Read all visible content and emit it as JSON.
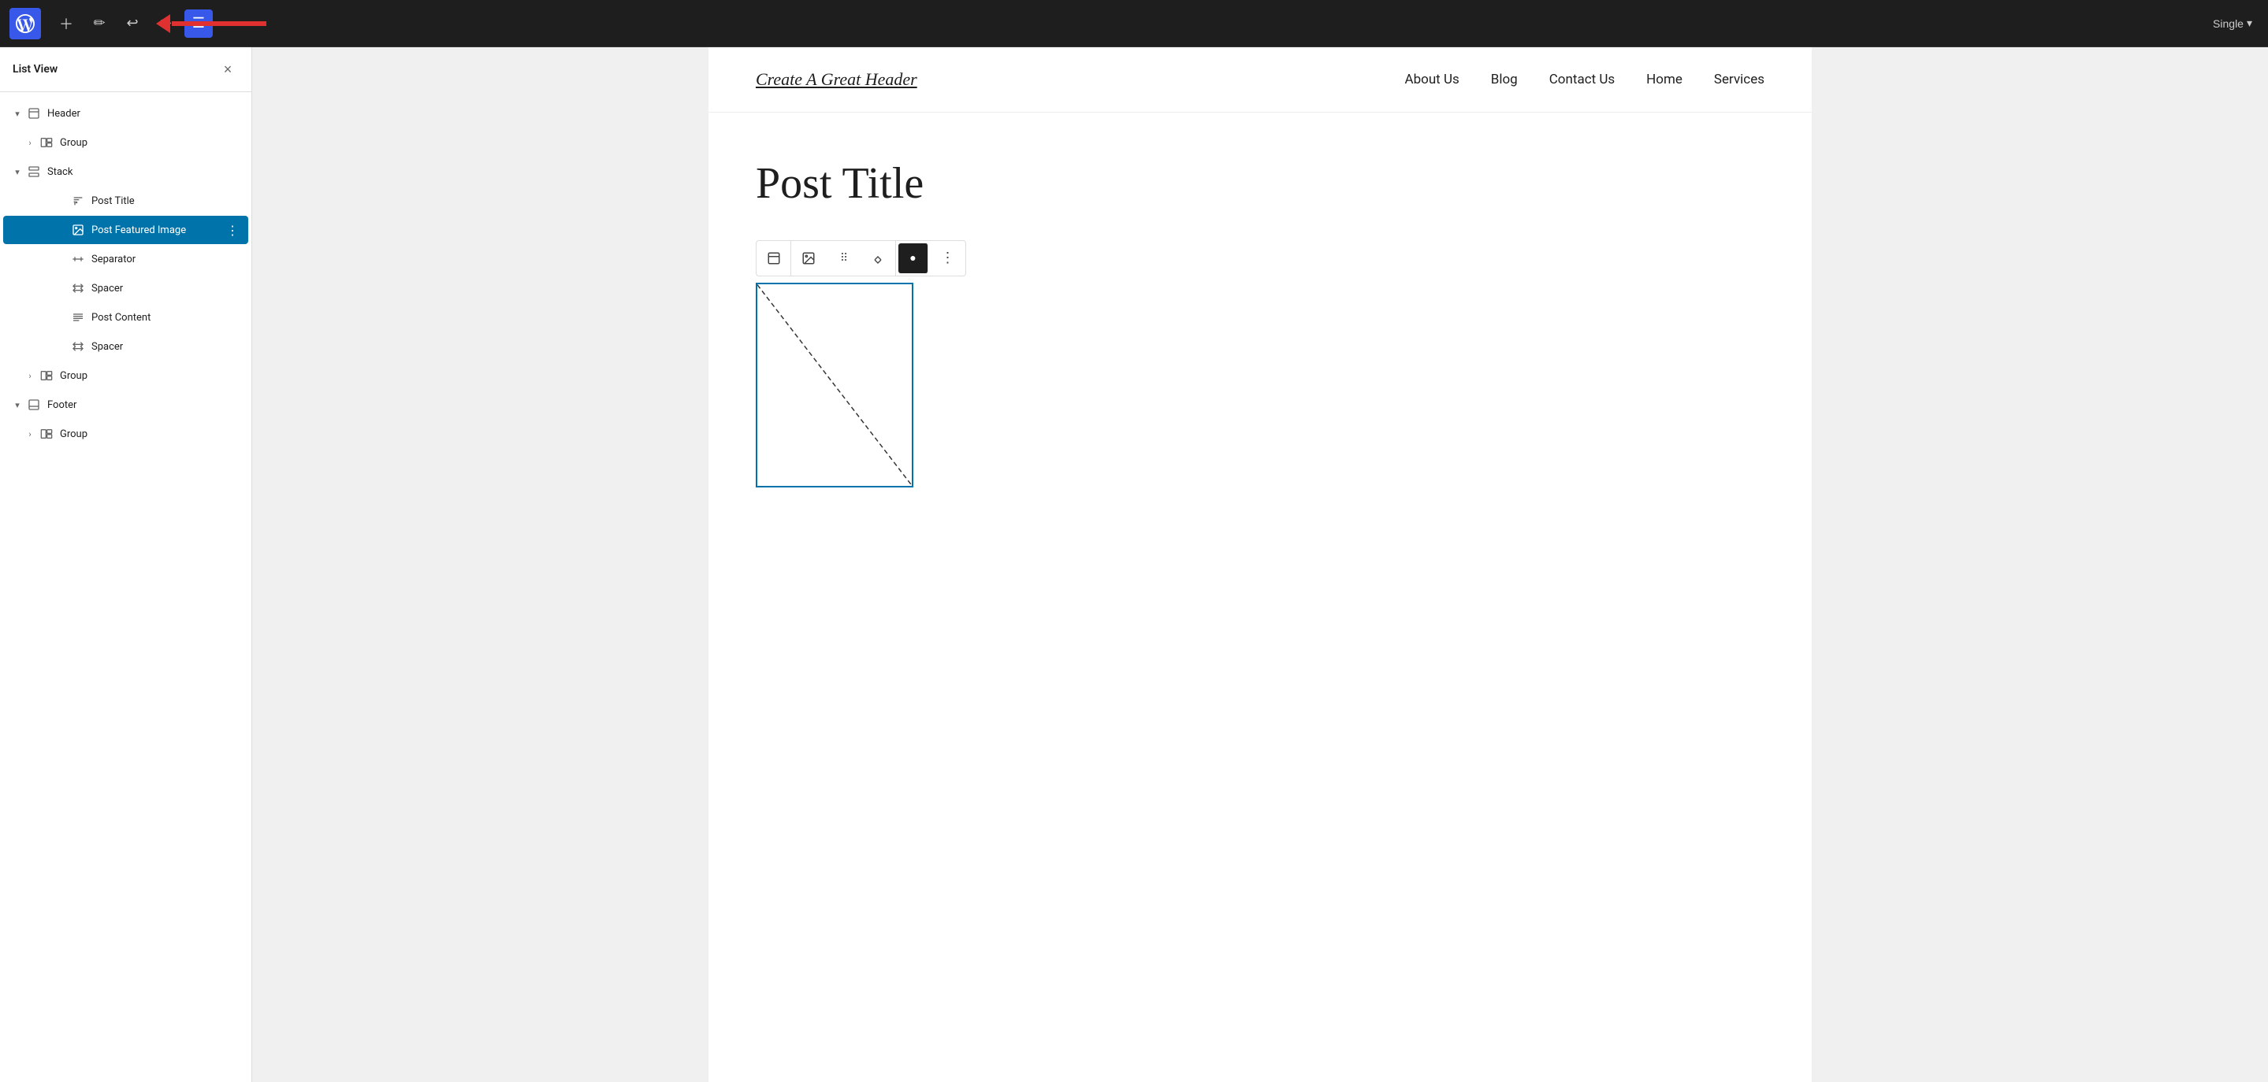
{
  "toolbar": {
    "list_view_label": "≡",
    "pencil_icon": "✏",
    "undo_icon": "↩",
    "redo_icon": "↪",
    "single_label": "Single",
    "dropdown_arrow": "▾"
  },
  "sidebar": {
    "title": "List View",
    "close_icon": "×",
    "items": [
      {
        "id": "header",
        "label": "Header",
        "indent": 0,
        "icon": "template",
        "chevron": "▾",
        "expanded": true
      },
      {
        "id": "group1",
        "label": "Group",
        "indent": 1,
        "icon": "group",
        "chevron": "›",
        "expanded": false
      },
      {
        "id": "stack",
        "label": "Stack",
        "indent": 0,
        "icon": "stack",
        "chevron": "▾",
        "expanded": true
      },
      {
        "id": "post-title",
        "label": "Post Title",
        "indent": 2,
        "icon": "title",
        "chevron": "",
        "expanded": false
      },
      {
        "id": "post-featured-image",
        "label": "Post Featured Image",
        "indent": 2,
        "icon": "image",
        "chevron": "",
        "expanded": false,
        "selected": true
      },
      {
        "id": "separator",
        "label": "Separator",
        "indent": 2,
        "icon": "separator",
        "chevron": "",
        "expanded": false
      },
      {
        "id": "spacer1",
        "label": "Spacer",
        "indent": 2,
        "icon": "spacer",
        "chevron": "",
        "expanded": false
      },
      {
        "id": "post-content",
        "label": "Post Content",
        "indent": 2,
        "icon": "content",
        "chevron": "",
        "expanded": false
      },
      {
        "id": "spacer2",
        "label": "Spacer",
        "indent": 2,
        "icon": "spacer",
        "chevron": "",
        "expanded": false
      },
      {
        "id": "group2",
        "label": "Group",
        "indent": 1,
        "icon": "group",
        "chevron": "›",
        "expanded": false
      },
      {
        "id": "footer",
        "label": "Footer",
        "indent": 0,
        "icon": "footer",
        "chevron": "▾",
        "expanded": true
      },
      {
        "id": "group3",
        "label": "Group",
        "indent": 1,
        "icon": "group",
        "chevron": "›",
        "expanded": false
      }
    ]
  },
  "canvas": {
    "header": {
      "logo": "Create A Great Header",
      "nav_items": [
        "About Us",
        "Blog",
        "Contact Us",
        "Home",
        "Services"
      ]
    },
    "post": {
      "title": "Post Title"
    },
    "image_toolbar": {
      "block_type_icon": "⊞",
      "image_icon": "▣",
      "drag_icon": "⠿",
      "arrows_icon": "⇅",
      "brush_icon": "●",
      "more_icon": "⋮"
    }
  }
}
